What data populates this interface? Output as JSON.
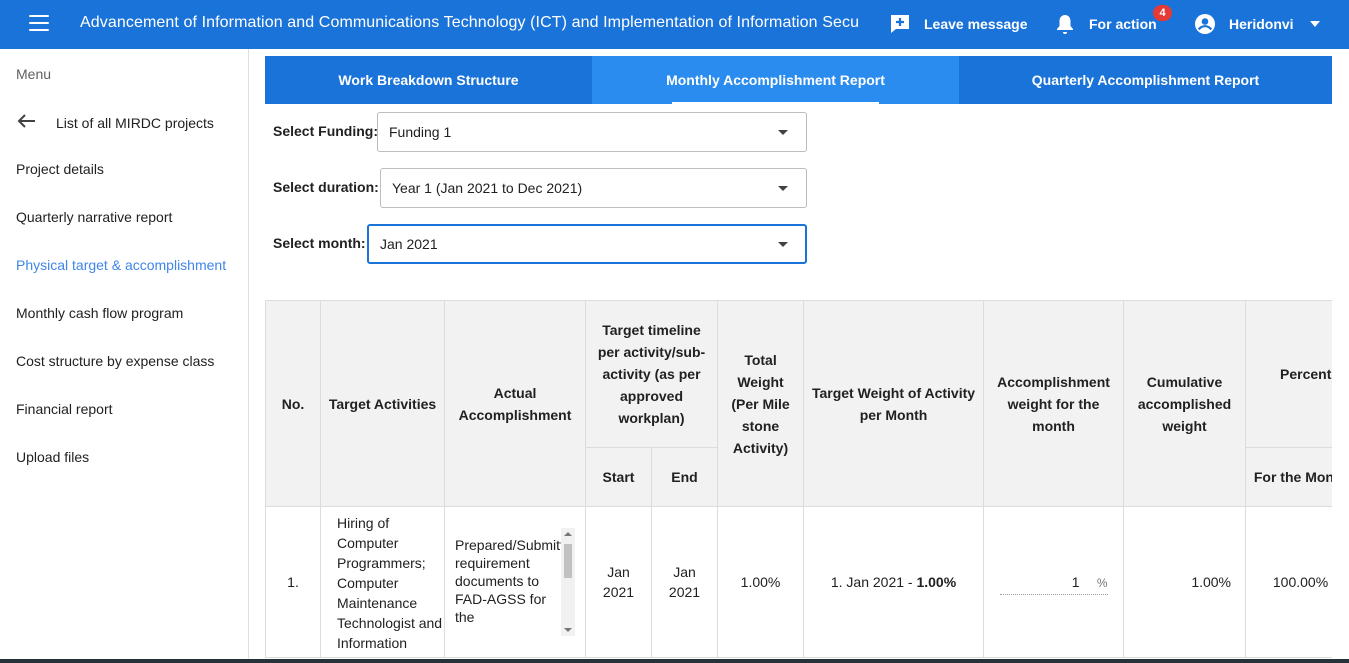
{
  "header": {
    "title": "Advancement of Information and Communications Technology (ICT) and Implementation of Information Secu",
    "leave_message": "Leave message",
    "for_action": "For action",
    "for_action_count": "4",
    "user_name": "Heridonvi",
    "icons": [
      "menu-icon",
      "add-comment-icon",
      "bell-icon",
      "account-circle-icon",
      "caret-down-icon"
    ]
  },
  "sidebar": {
    "heading": "Menu",
    "back_label": "List of all MIRDC projects",
    "items": [
      {
        "label": "Project details"
      },
      {
        "label": "Quarterly narrative report"
      },
      {
        "label": "Physical target & accomplishment",
        "active": true
      },
      {
        "label": "Monthly cash flow program"
      },
      {
        "label": "Cost structure by expense class"
      },
      {
        "label": "Financial report"
      },
      {
        "label": "Upload files"
      }
    ],
    "active_color": "#3f86e8"
  },
  "tabs": [
    {
      "label": "Work Breakdown Structure"
    },
    {
      "label": "Monthly Accomplishment Report",
      "active": true
    },
    {
      "label": "Quarterly Accomplishment Report"
    }
  ],
  "filters": {
    "funding": {
      "label": "Select Funding:",
      "value": "Funding 1"
    },
    "duration": {
      "label": "Select duration:",
      "value": "Year 1 (Jan 2021 to Dec 2021)"
    },
    "month": {
      "label": "Select month:",
      "value": "Jan 2021"
    }
  },
  "table": {
    "headers": {
      "no": "No.",
      "target_activities": "Target Activities",
      "actual_accomplishment": "Actual Accomplishment",
      "target_timeline": "Target timeline per activity/sub-activity (as per approved workplan)",
      "start": "Start",
      "end": "End",
      "total_weight": "Total Weight (Per Mile stone Activity)",
      "target_weight_month": "Target Weight of Activity per Month",
      "accomp_weight_month": "Accomplishment weight for the month",
      "cumulative_weight": "Cumulative accomplished weight",
      "percent_accomp": "Percent Accomplishment",
      "for_the_month": "For the Month"
    },
    "rows": [
      {
        "no": "1.",
        "target_activity": "Hiring of Computer Programmers; Computer Maintenance Technologist and Information",
        "actual_accomplishment": "Prepared/Submitted requirement documents to FAD-AGSS for the",
        "start": "Jan 2021",
        "end": "Jan 2021",
        "total_weight": "1.00%",
        "target_weight_prefix": "1. Jan 2021 - ",
        "target_weight_value": "1.00%",
        "accomp_weight_value": "1",
        "accomp_weight_unit": "%",
        "cumulative": "1.00%",
        "percent_for_month": "100.00%"
      }
    ]
  },
  "colors": {
    "primary": "#1a73d9",
    "active_tab": "#2b8cf0",
    "badge": "#e53935"
  }
}
